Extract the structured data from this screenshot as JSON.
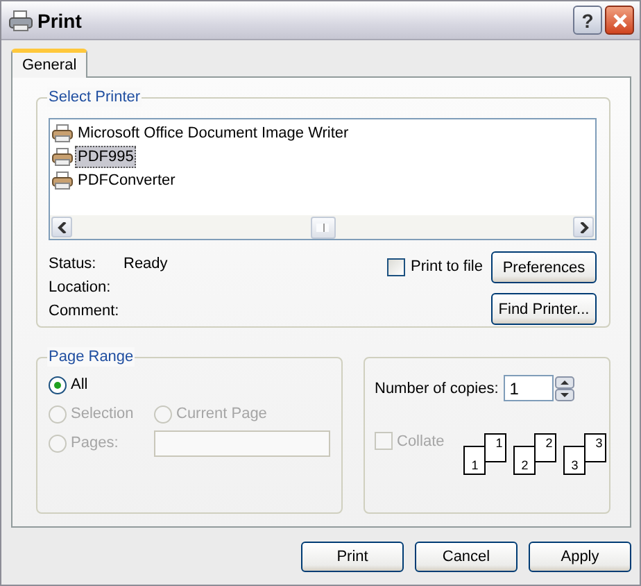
{
  "window": {
    "title": "Print",
    "help_button": "?"
  },
  "tabs": [
    {
      "label": "General",
      "selected": true
    }
  ],
  "select_printer": {
    "legend": "Select Printer",
    "printers": [
      {
        "name": "Microsoft Office Document Image Writer",
        "selected": false
      },
      {
        "name": "PDF995",
        "selected": true
      },
      {
        "name": "PDFConverter",
        "selected": false
      }
    ],
    "info": [
      {
        "label": "Status:",
        "value": "Ready"
      },
      {
        "label": "Location:"
      },
      {
        "label": "Comment:"
      }
    ],
    "print_to_file": {
      "label": "Print to file",
      "checked": false
    },
    "buttons": [
      "Preferences",
      "Find Printer..."
    ]
  },
  "page_range": {
    "legend": "Page Range",
    "options": [
      {
        "label": "All",
        "selected": true,
        "disabled": false
      },
      {
        "label": "Selection",
        "selected": false,
        "disabled": true
      },
      {
        "label": "Current Page",
        "selected": false,
        "disabled": true
      },
      {
        "label": "Pages:",
        "selected": false,
        "disabled": true
      }
    ]
  },
  "copies": {
    "label": "Number of copies:",
    "value": "1",
    "collate": {
      "label": "Collate",
      "checked": false,
      "disabled": true
    },
    "collate_sets": [
      {
        "front": "1",
        "back": "1"
      },
      {
        "front": "2",
        "back": "2"
      },
      {
        "front": "3",
        "back": "3"
      }
    ]
  },
  "buttons": [
    "Print",
    "Cancel",
    "Apply"
  ]
}
